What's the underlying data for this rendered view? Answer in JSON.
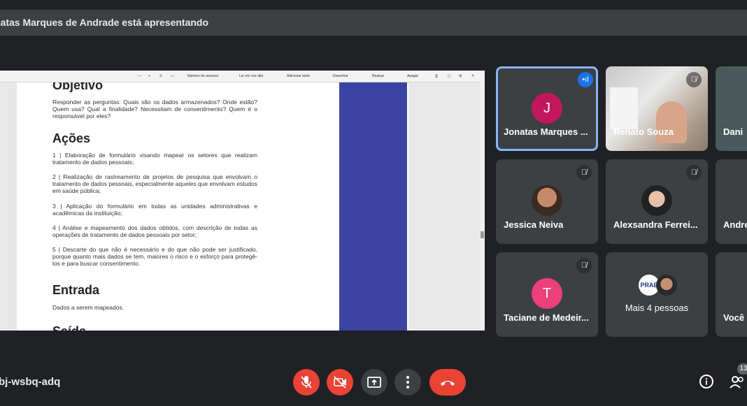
{
  "banner": {
    "text": "natas Marques de Andrade está apresentando"
  },
  "pdf_toolbar": {
    "items": [
      "Número de acessos",
      "Ler em voz alta",
      "Adicionar texto",
      "Desenhar",
      "Realçar",
      "Apagar"
    ]
  },
  "document": {
    "heading_top": "Objetivo",
    "objetivo_text": "Responder as perguntas: Quais são os dados armazenados? Onde estão? Quem usa? Qual a finalidade? Necessitam de consentimento? Quem é o responsável por eles?",
    "heading_acoes": "Ações",
    "acoes": [
      "1 | Elaboração de formulário visando mapear os setores que realizam tratamento de dados pessoais;",
      "2 | Realização de rastreamento de projetos de pesquisa que envolvam o tratamento de dados pessoais, especialmente aqueles que envolvam estudos em saúde pública;",
      "3 | Aplicação do formulário em todas as unidades administrativas e acadêmicas da instituição;",
      "4 | Análise e mapeamento dos dados obtidos, com descrição de todas as operações de tratamento de dados pessoais por setor;",
      "5 | Descarte do que não é necessário e do que não pode ser justificado, porque quanto mais dados se tem, maiores o risco e o esforço para protegê-los e para buscar consentimento."
    ],
    "heading_entrada": "Entrada",
    "entrada_text": "Dados a serem mapeados.",
    "heading_partial": "Saída"
  },
  "participants": [
    {
      "name": "Jonatas Marques ...",
      "initial": "J",
      "avatar_color": "#c2185b",
      "speaking": true
    },
    {
      "name": "Renato Souza",
      "muted": true
    },
    {
      "name": "Dani"
    },
    {
      "name": "Jessica Neiva",
      "muted": true
    },
    {
      "name": "Alexsandra Ferrei...",
      "muted": true
    },
    {
      "name": "Andre"
    },
    {
      "name": "Taciane de Medeir...",
      "initial": "T",
      "avatar_color": "#ec407a",
      "muted": true
    },
    {
      "name": "Mais 4 pessoas",
      "badge": "PRAE"
    },
    {
      "name": "Você"
    }
  ],
  "meeting": {
    "code": "bj-wsbq-adq",
    "people_count": "13"
  },
  "colors": {
    "end_call": "#ea4335",
    "speaking_border": "#8ab4f8",
    "band": "#3a44a0"
  }
}
